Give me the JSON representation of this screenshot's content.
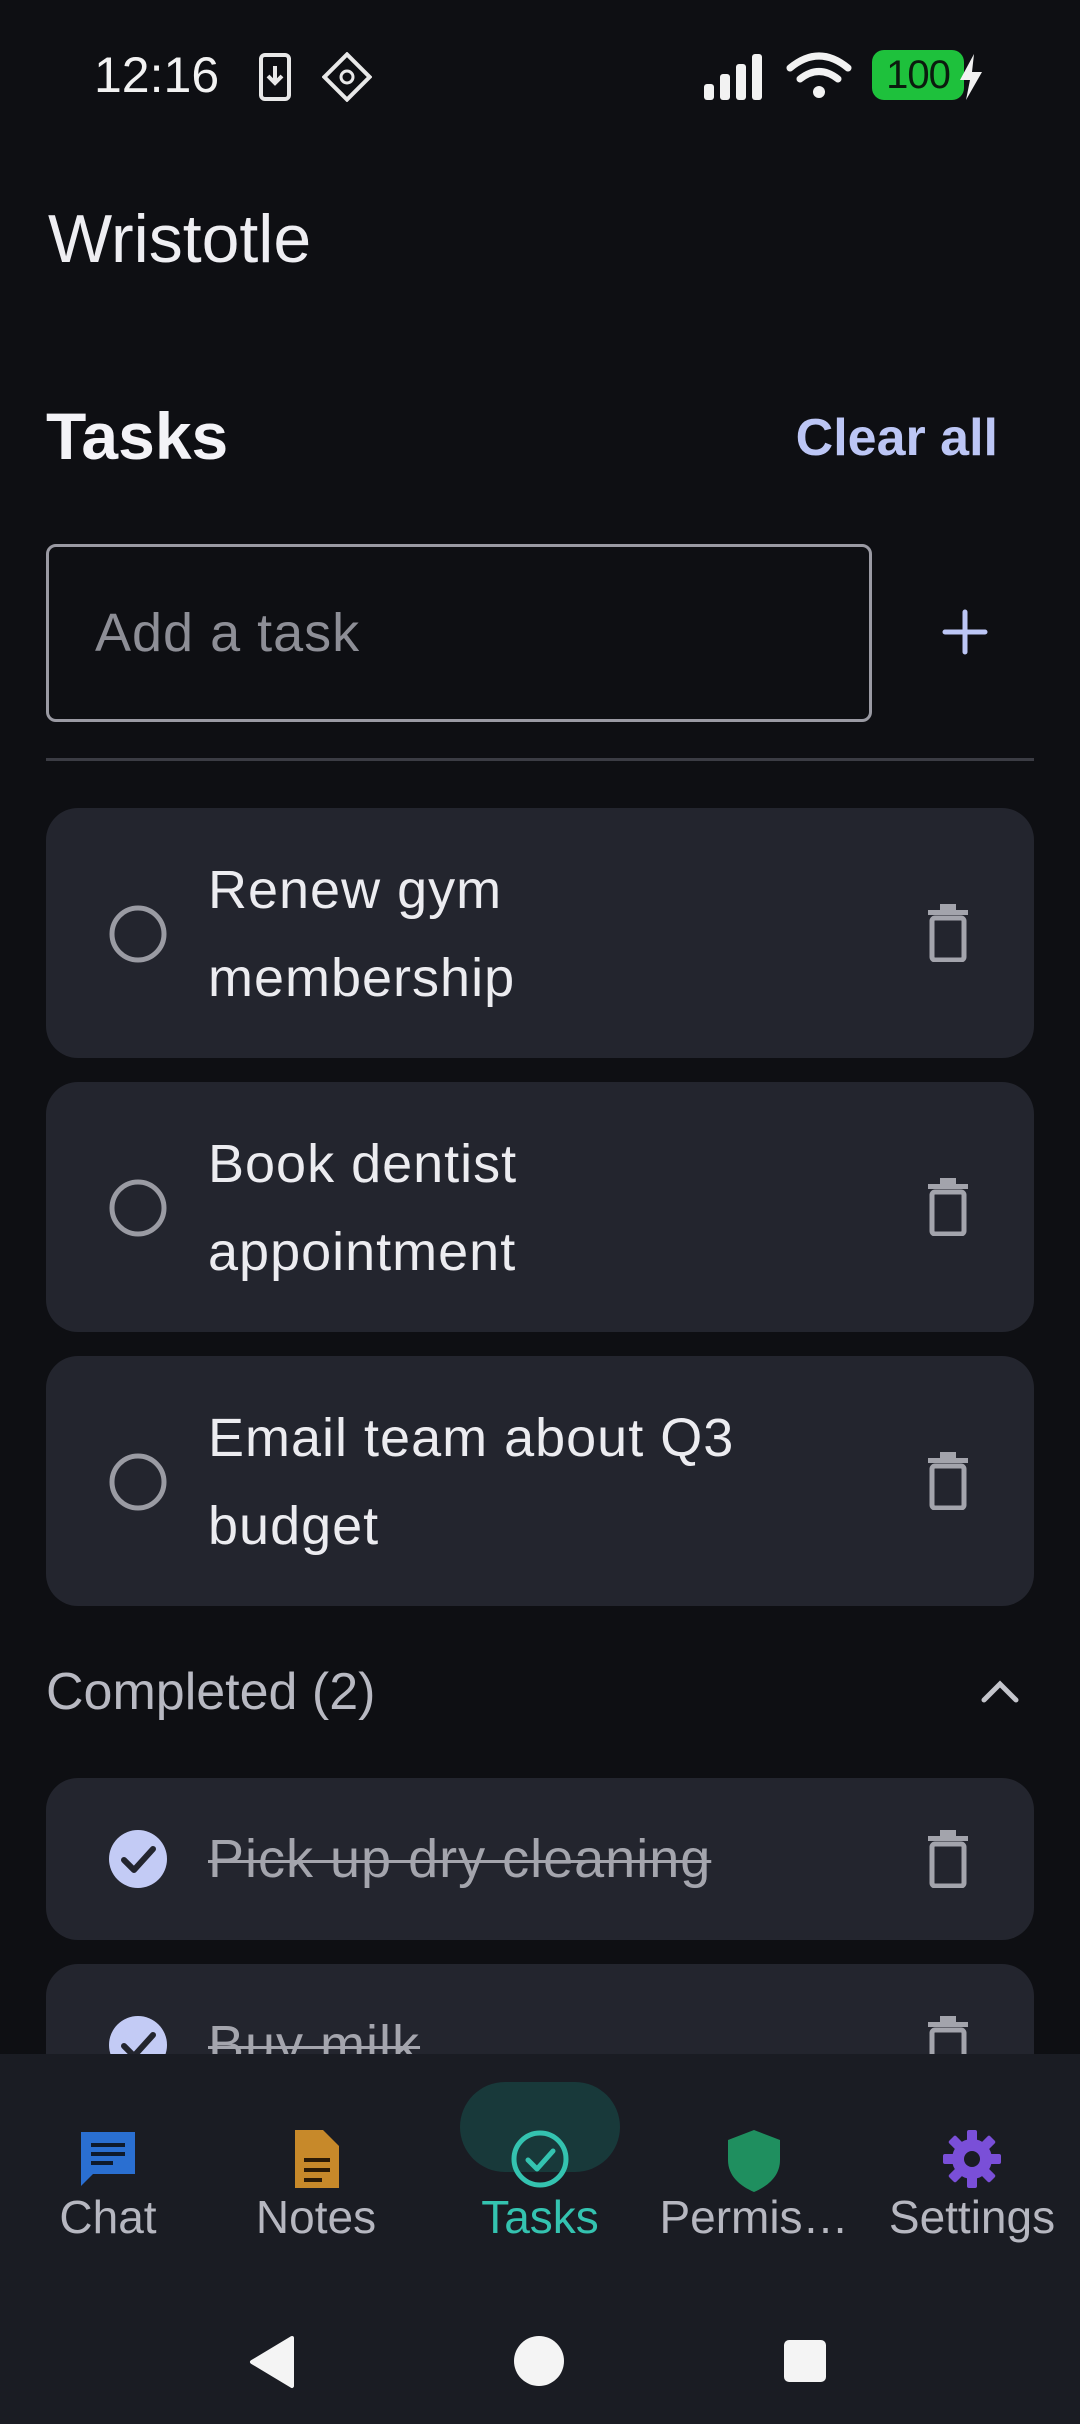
{
  "status": {
    "time": "12:16",
    "battery": "100",
    "icons": [
      "download-icon",
      "crosshair-icon",
      "signal-icon",
      "wifi-icon",
      "battery-charging-icon"
    ]
  },
  "app": {
    "title": "Wristotle"
  },
  "tasks_header": {
    "title": "Tasks",
    "clear_all": "Clear all"
  },
  "add_task": {
    "placeholder": "Add a task",
    "value": ""
  },
  "open_tasks": [
    {
      "line1": "Renew gym",
      "line2": "membership"
    },
    {
      "line1": "Book dentist",
      "line2": "appointment"
    },
    {
      "line1": "Email team about Q3",
      "line2": "budget"
    }
  ],
  "completed": {
    "header": "Completed (2)",
    "items": [
      {
        "text": "Pick up dry cleaning"
      },
      {
        "text": "Buy milk"
      }
    ]
  },
  "bottom_nav": [
    {
      "label": "Chat",
      "icon": "chat-icon",
      "color": "#2a6fd1"
    },
    {
      "label": "Notes",
      "icon": "note-icon",
      "color": "#c7892a"
    },
    {
      "label": "Tasks",
      "icon": "check-circle-icon",
      "color": "#34c3b0",
      "active": true
    },
    {
      "label": "Permis…",
      "icon": "shield-icon",
      "color": "#1f8f5f"
    },
    {
      "label": "Settings",
      "icon": "gear-icon",
      "color": "#7a4fd8"
    }
  ],
  "colors": {
    "accent": "#bcc6f5",
    "active_tab": "#34c3b0",
    "card": "#23252e",
    "background": "#0e0f13"
  }
}
